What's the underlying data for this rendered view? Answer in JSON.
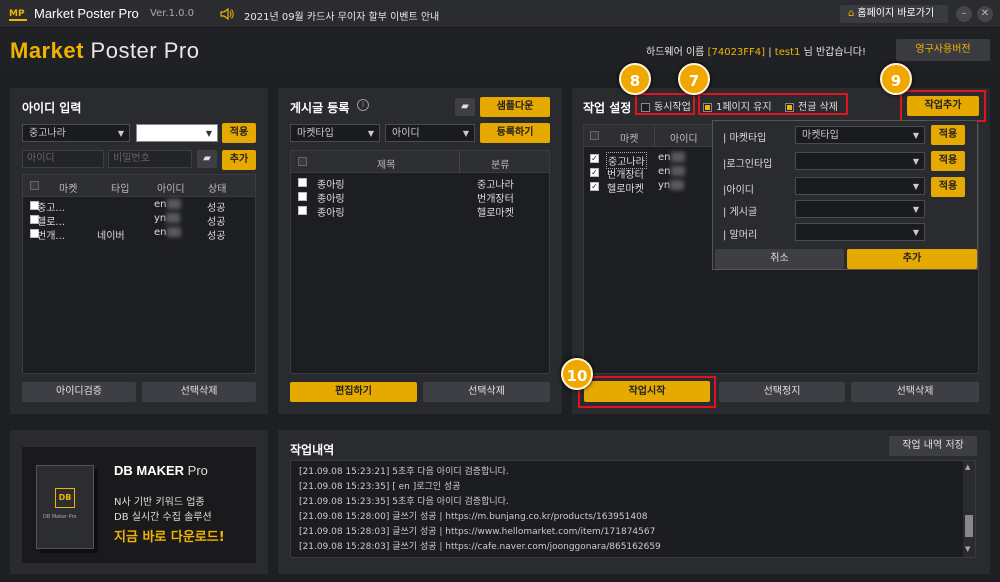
{
  "titlebar": {
    "logo": "MP",
    "title": "Market Poster Pro",
    "version": "Ver.1.0.0",
    "notice": "2021년 09월 카드사 무이자 할부 이벤트 안내",
    "home_button": "홈페이지 바로가기",
    "minimize": "–",
    "close": "✕"
  },
  "header": {
    "brand_part1": "Market",
    "brand_part2": " Poster Pro",
    "hw_label": "하드웨어 이름",
    "hw_id": "[74023FF4]",
    "user": "test1",
    "greeting": "님 반갑습니다!",
    "license_button": "영구사용버전"
  },
  "id_panel": {
    "title": "아이디 입력",
    "market_select": "중고나라",
    "apply_label": "적용",
    "id_placeholder": "아이디",
    "pw_placeholder": "비밀번호",
    "add_label": "추가",
    "columns": [
      "마켓",
      "타입",
      "아이디",
      "상태"
    ],
    "rows": [
      {
        "market": "중고...",
        "type": "",
        "id": "en",
        "status": "성공"
      },
      {
        "market": "헬로...",
        "type": "",
        "id": "yn",
        "status": "성공"
      },
      {
        "market": "번개...",
        "type": "네이버",
        "id": "en",
        "status": "성공"
      }
    ],
    "verify_button": "아이디검증",
    "delete_button": "선택삭제"
  },
  "post_panel": {
    "title": "게시글 등록",
    "sample_button": "샘플다운",
    "market_select": "마켓타입",
    "id_select": "아이디",
    "register_button": "등록하기",
    "columns": [
      "제목",
      "분류"
    ],
    "rows": [
      {
        "title": "종아링",
        "category": "중고나라"
      },
      {
        "title": "종아링",
        "category": "번개장터"
      },
      {
        "title": "종아링",
        "category": "헬로마켓"
      }
    ],
    "edit_button": "편집하기",
    "delete_button": "선택삭제"
  },
  "task_panel": {
    "title": "작업 설정",
    "concurrent_label": "동시작업",
    "keep_page_label": "1페이지 유지",
    "delete_all_label": "전글 삭제",
    "add_task_button": "작업추가",
    "columns": [
      "마켓",
      "아이디"
    ],
    "rows": [
      {
        "market": "중고나라",
        "id": "en"
      },
      {
        "market": "번개장터",
        "id": "en"
      },
      {
        "market": "헬로마켓",
        "id": "yn"
      }
    ],
    "start_button": "작업시작",
    "stop_button": "선택정지",
    "delete_button": "선택삭제"
  },
  "popup": {
    "rows": [
      {
        "label": "| 마켓타입",
        "value": "마켓타입",
        "button": "적용"
      },
      {
        "label": "|로그인타입",
        "value": "",
        "button": "적용"
      },
      {
        "label": "|아이디",
        "value": "",
        "button": "적용"
      },
      {
        "label": "| 게시글",
        "value": ""
      },
      {
        "label": "| 말머리",
        "value": ""
      }
    ],
    "cancel_button": "취소",
    "add_button": "추가"
  },
  "badges": [
    "8",
    "7",
    "9",
    "10"
  ],
  "ad": {
    "title_part1": "DB MAKER",
    "title_part2": " Pro",
    "line1": "N사 기반 키워드 업종",
    "line2": "DB 실시간 수집 솔루션",
    "cta": "지금 바로 다운로드!",
    "box_logo": "DB",
    "box_text": "DB Maker Pro"
  },
  "log_panel": {
    "title": "작업내역",
    "save_button": "작업 내역 저장",
    "lines": [
      "[21.09.08 15:23:21]   5초후 다음 아이디 검증합니다.",
      "[21.09.08 15:23:35]   [ en        ]로그인 성공",
      "[21.09.08 15:23:35]   5초후 다음 아이디 검증합니다.",
      "[21.09.08 15:28:00]   글쓰기 성공 | https://m.bunjang.co.kr/products/163951408",
      "[21.09.08 15:28:03]   글쓰기 성공 | https://www.hellomarket.com/item/171874567",
      "[21.09.08 15:28:03]   글쓰기 성공 | https://cafe.naver.com/joonggonara/865162659"
    ]
  },
  "colors": {
    "accent": "#e5a900",
    "highlight": "#e0141e",
    "background": "#1e1f22",
    "panel": "#2a2b2f"
  }
}
